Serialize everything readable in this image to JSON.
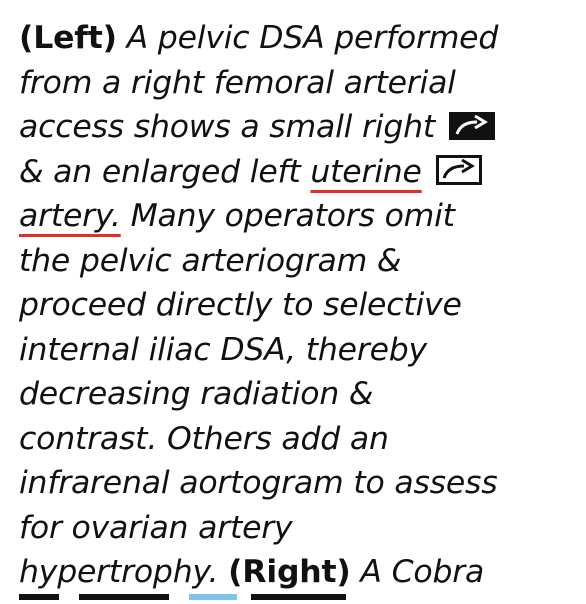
{
  "caption": {
    "left_label": "(Left)",
    "lines": [
      "A pelvic DSA performed",
      "from a right femoral arterial",
      "access shows a small right",
      "& an enlarged left",
      "uterine",
      "artery.",
      "Many operators omit",
      "the pelvic arteriogram &",
      "proceed directly to selective",
      "internal iliac DSA, thereby",
      "decreasing radiation &",
      "contrast. Others add an",
      "infrarenal aortogram to assess",
      "for ovarian artery",
      "hypertrophy.",
      "A Cobra"
    ],
    "right_label": "(Right)"
  },
  "icons": {
    "solid_arrow": "solid-curved-arrow-icon",
    "open_arrow": "open-curved-arrow-icon"
  },
  "colors": {
    "text": "#111111",
    "underline": "#e0302b",
    "partial_highlight": "#7fc3e8"
  }
}
